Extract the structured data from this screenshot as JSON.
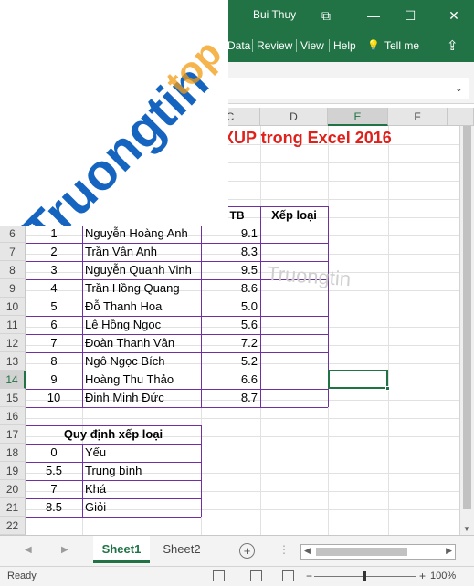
{
  "titlebar": {
    "user": "Bui Thuy",
    "restore_glyph": "⧉",
    "min_glyph": "—",
    "max_glyph": "☐",
    "close_glyph": "✕"
  },
  "ribbon": {
    "tabs": [
      "Data",
      "Review",
      "View",
      "Help"
    ],
    "tell_me": "Tell me",
    "bulb_glyph": "💡",
    "share_glyph": "⇪"
  },
  "formula_bar": {
    "chevron": "⌄"
  },
  "sheet": {
    "title": "XUP trong Excel 2016",
    "columns": [
      "C",
      "D",
      "E",
      "F"
    ],
    "selected_column": "E",
    "selected_row": "14",
    "row_numbers": [
      "6",
      "7",
      "8",
      "9",
      "10",
      "11",
      "12",
      "13",
      "14",
      "15",
      "16",
      "17",
      "18",
      "19",
      "20",
      "21",
      "22"
    ],
    "table1": {
      "header_score": "m TB",
      "header_rank": "Xếp loại",
      "rows": [
        {
          "stt": "1",
          "name": "Nguyễn Hoàng Anh",
          "score": "9.1"
        },
        {
          "stt": "2",
          "name": "Trần Vân Anh",
          "score": "8.3"
        },
        {
          "stt": "3",
          "name": "Nguyễn Quanh Vinh",
          "score": "9.5"
        },
        {
          "stt": "4",
          "name": "Trần Hồng Quang",
          "score": "8.6"
        },
        {
          "stt": "5",
          "name": "Đỗ Thanh Hoa",
          "score": "5.0"
        },
        {
          "stt": "6",
          "name": "Lê Hồng Ngọc",
          "score": "5.6"
        },
        {
          "stt": "7",
          "name": "Đoàn Thanh Vân",
          "score": "7.2"
        },
        {
          "stt": "8",
          "name": "Ngô Ngọc Bích",
          "score": "5.2"
        },
        {
          "stt": "9",
          "name": "Hoàng Thu Thảo",
          "score": "6.6"
        },
        {
          "stt": "10",
          "name": "Đinh Minh Đức",
          "score": "8.7"
        }
      ]
    },
    "table2": {
      "header": "Quy định xếp loại",
      "rows": [
        {
          "threshold": "0",
          "label": "Yếu"
        },
        {
          "threshold": "5.5",
          "label": "Trung bình"
        },
        {
          "threshold": "7",
          "label": "Khá"
        },
        {
          "threshold": "8.5",
          "label": "Giỏi"
        }
      ]
    }
  },
  "watermark": {
    "brand": "Truongtin",
    "suffix": "top",
    "faint": "Truongtin"
  },
  "sheet_tabs": {
    "tabs": [
      "Sheet1",
      "Sheet2"
    ],
    "active": "Sheet1",
    "add_glyph": "+",
    "prev_glyph": "◀",
    "next_glyph": "▶"
  },
  "status": {
    "ready": "Ready",
    "zoom": "100%",
    "minus": "−",
    "plus": "+"
  },
  "colors": {
    "excel_green": "#217346",
    "title_red": "#e0201b",
    "border_purple": "#7030a0"
  }
}
